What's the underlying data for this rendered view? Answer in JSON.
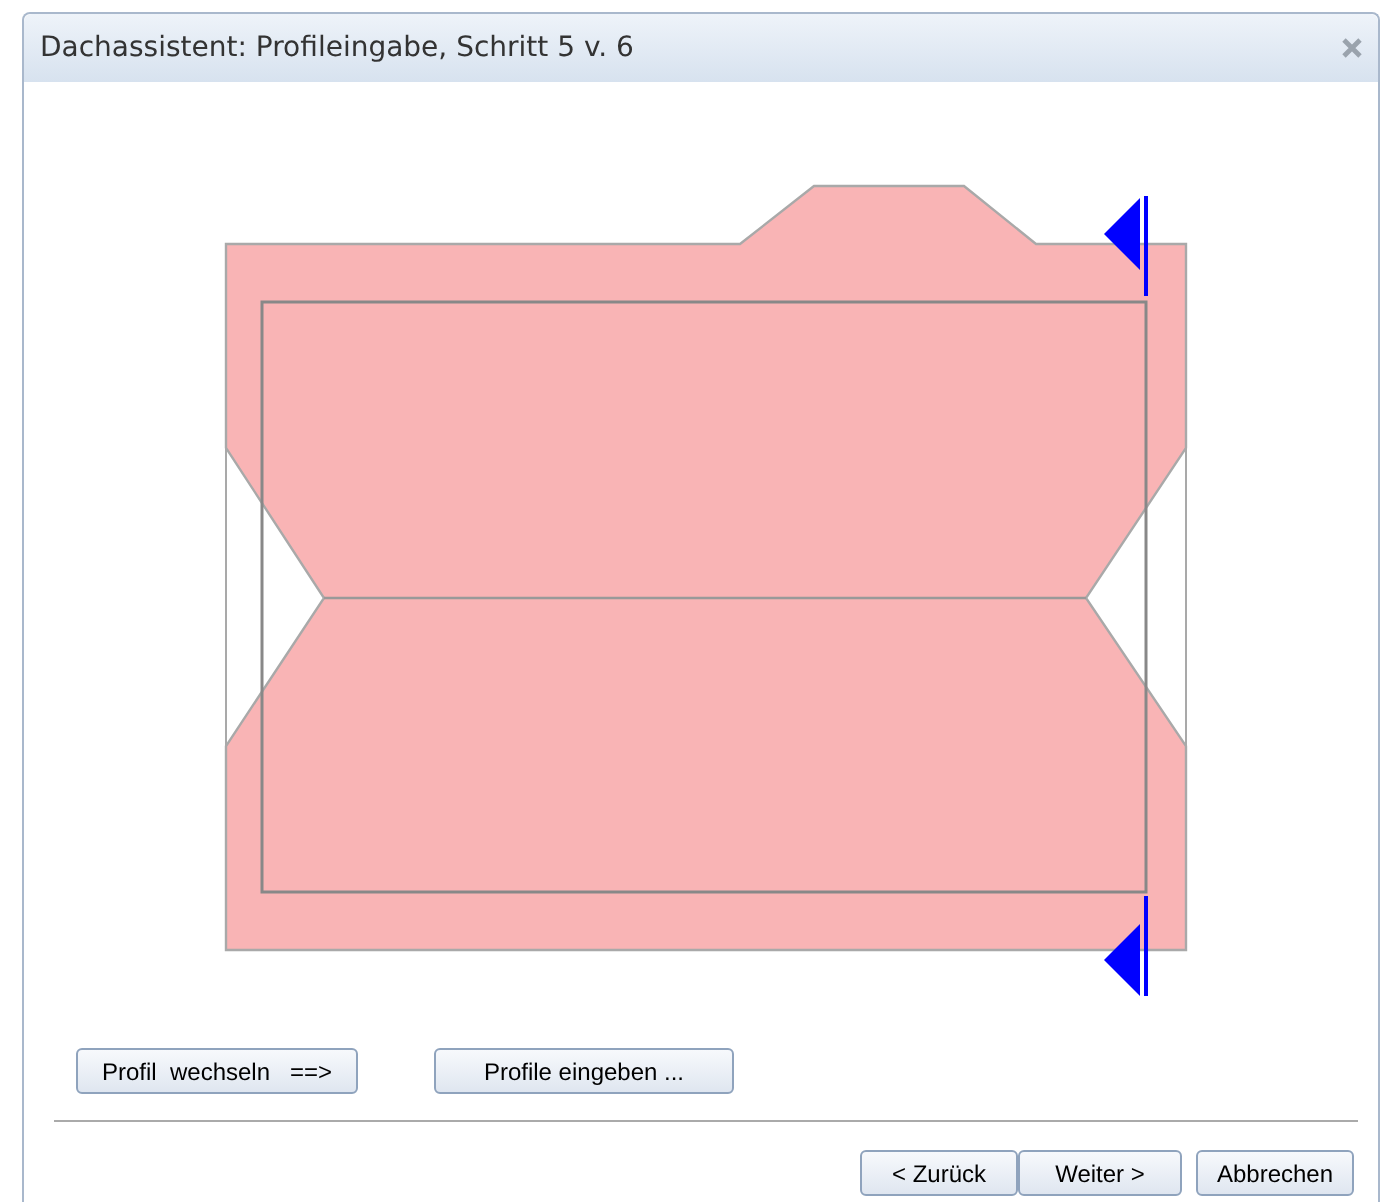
{
  "window": {
    "title": "Dachassistent: Profileingabe, Schritt 5 v. 6"
  },
  "tool_buttons": [
    "Profil  wechseln   ==>",
    "Profile eingeben ..."
  ],
  "nav_buttons": [
    "< Zurück",
    "Weiter >",
    "Abbrechen"
  ]
}
